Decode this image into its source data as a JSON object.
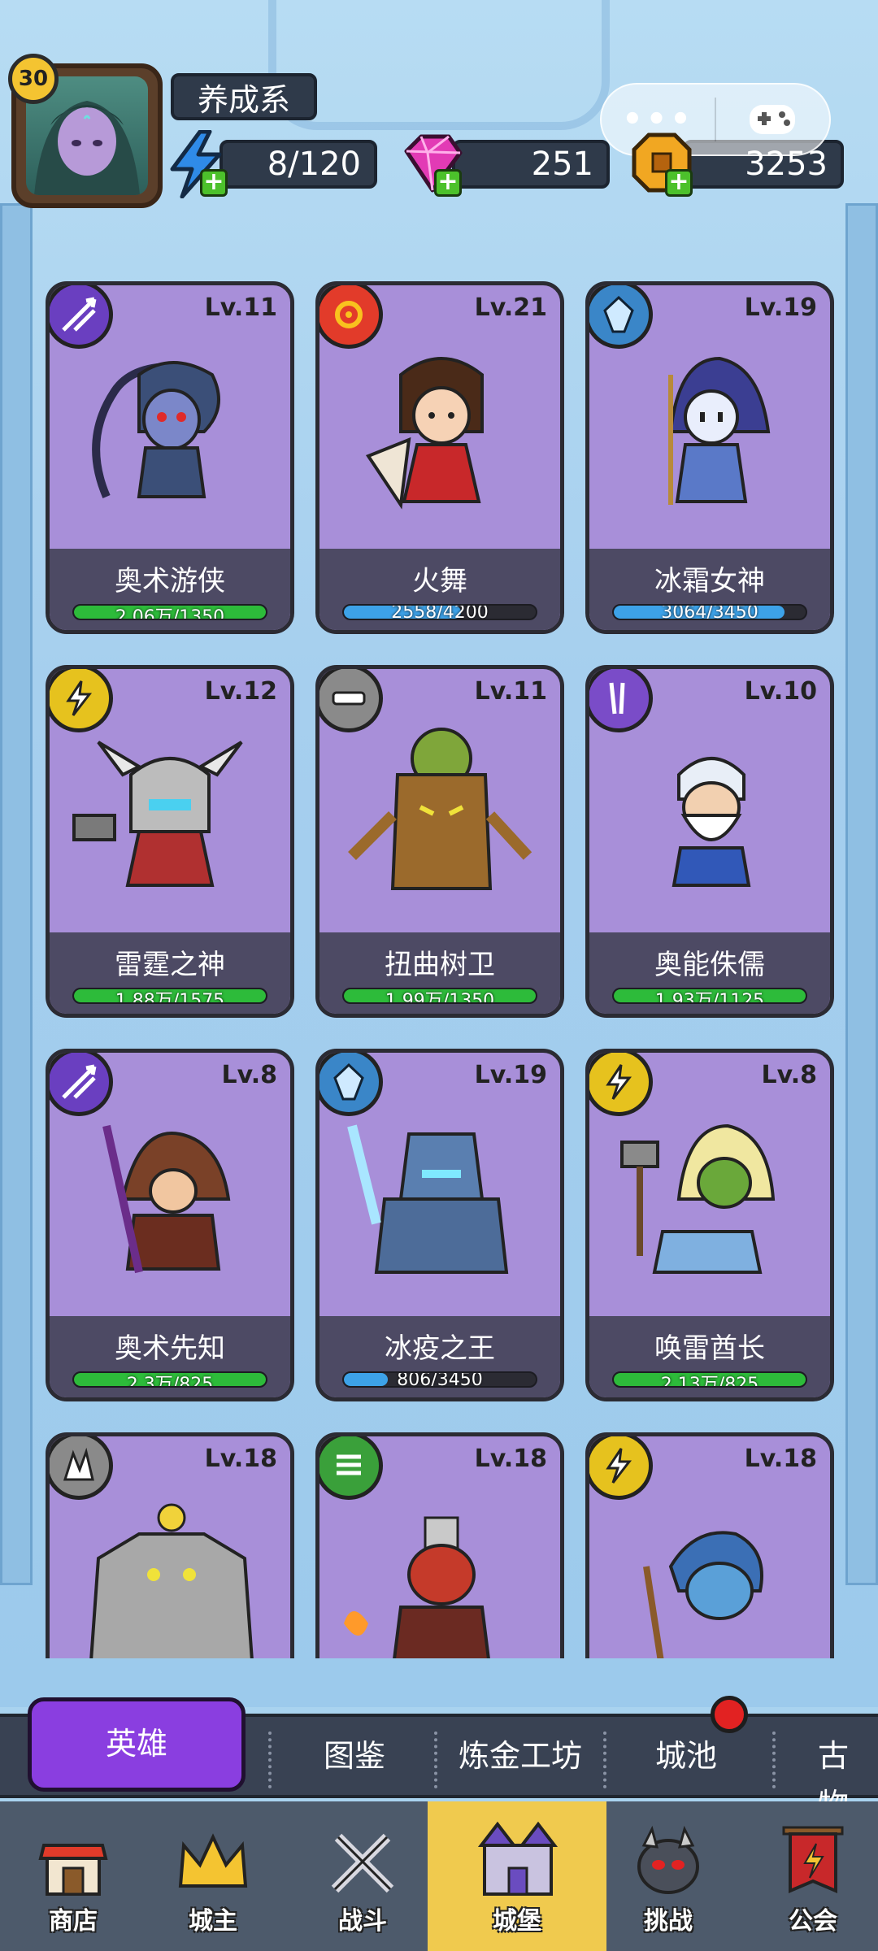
{
  "player": {
    "level": "30",
    "name": "养成系"
  },
  "resources": {
    "energy": "8/120",
    "gems": "251",
    "gold": "3253"
  },
  "heroes": [
    {
      "name": "奥术游侠",
      "level": "Lv.11",
      "progress": "2.06万/1350",
      "fill": 1.0,
      "bar_color": "#2dbb3a",
      "element": "arrows-icon",
      "element_color": "#6a3fc0"
    },
    {
      "name": "火舞",
      "level": "Lv.21",
      "progress": "2558/4200",
      "fill": 0.61,
      "bar_color": "#3da2e8",
      "element": "fire-ring-icon",
      "element_color": "#e23b2a"
    },
    {
      "name": "冰霜女神",
      "level": "Lv.19",
      "progress": "3064/3450",
      "fill": 0.89,
      "bar_color": "#3da2e8",
      "element": "ice-crystal-icon",
      "element_color": "#3a86c8"
    },
    {
      "name": "雷霆之神",
      "level": "Lv.12",
      "progress": "1.88万/1575",
      "fill": 1.0,
      "bar_color": "#2dbb3a",
      "element": "lightning-icon",
      "element_color": "#e6c21e"
    },
    {
      "name": "扭曲树卫",
      "level": "Lv.11",
      "progress": "1.99万/1350",
      "fill": 1.0,
      "bar_color": "#2dbb3a",
      "element": "shield-icon",
      "element_color": "#8a8a8a"
    },
    {
      "name": "奥能侏儒",
      "level": "Lv.10",
      "progress": "1.93万/1125",
      "fill": 1.0,
      "bar_color": "#2dbb3a",
      "element": "arcane-icon",
      "element_color": "#7a4cc8"
    },
    {
      "name": "奥术先知",
      "level": "Lv.8",
      "progress": "2.3万/825",
      "fill": 1.0,
      "bar_color": "#2dbb3a",
      "element": "arrows-icon",
      "element_color": "#6a3fc0"
    },
    {
      "name": "冰疫之王",
      "level": "Lv.19",
      "progress": "806/3450",
      "fill": 0.23,
      "bar_color": "#3da2e8",
      "element": "ice-crystal-icon",
      "element_color": "#3a86c8"
    },
    {
      "name": "唤雷酋长",
      "level": "Lv.8",
      "progress": "2.13万/825",
      "fill": 1.0,
      "bar_color": "#2dbb3a",
      "element": "lightning-icon",
      "element_color": "#e6c21e"
    },
    {
      "name": "",
      "level": "Lv.18",
      "progress": "",
      "fill": 0,
      "bar_color": "#2dbb3a",
      "element": "rock-icon",
      "element_color": "#8a8a8a"
    },
    {
      "name": "",
      "level": "Lv.18",
      "progress": "",
      "fill": 0,
      "bar_color": "#2dbb3a",
      "element": "wind-icon",
      "element_color": "#3aa03a"
    },
    {
      "name": "",
      "level": "Lv.18",
      "progress": "",
      "fill": 0,
      "bar_color": "#2dbb3a",
      "element": "lightning-icon",
      "element_color": "#e6c21e"
    }
  ],
  "tabs": {
    "active": "英雄",
    "items": [
      "图鉴",
      "炼金工坊",
      "城池",
      "古物"
    ]
  },
  "nav": [
    {
      "label": "商店",
      "icon": "shop-icon"
    },
    {
      "label": "城主",
      "icon": "crown-icon"
    },
    {
      "label": "战斗",
      "icon": "swords-icon"
    },
    {
      "label": "城堡",
      "icon": "castle-icon",
      "active": true
    },
    {
      "label": "挑战",
      "icon": "demon-icon"
    },
    {
      "label": "公会",
      "icon": "guild-banner-icon"
    }
  ],
  "colors": {
    "card_bg": "#a88fd9",
    "tab_active": "#8a3ee0",
    "nav_active": "#f0ca4e"
  }
}
